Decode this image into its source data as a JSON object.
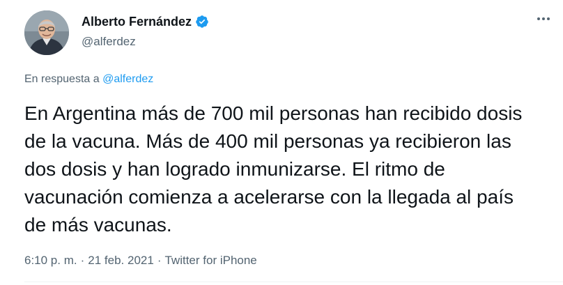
{
  "author": {
    "display_name": "Alberto Fernández",
    "handle": "@alferdez",
    "verified": true,
    "avatar_icon": "profile-photo"
  },
  "reply_context": {
    "prefix": "En respuesta a ",
    "mention": "@alferdez"
  },
  "tweet": {
    "text": "En Argentina más de 700 mil personas han recibido dosis de la vacuna. Más de 400 mil personas ya recibieron las dos dosis y han logrado inmunizarse. El ritmo de vacunación comienza a acelerarse con la llegada al país de más vacunas."
  },
  "meta": {
    "time": "6:10 p. m.",
    "separator": "·",
    "date": "21 feb. 2021",
    "source": "Twitter for iPhone"
  },
  "icons": {
    "verified": "verified-badge-icon",
    "more": "more-options-icon"
  },
  "colors": {
    "accent": "#1d9bf0",
    "text_primary": "#0f1419",
    "text_secondary": "#536471"
  }
}
